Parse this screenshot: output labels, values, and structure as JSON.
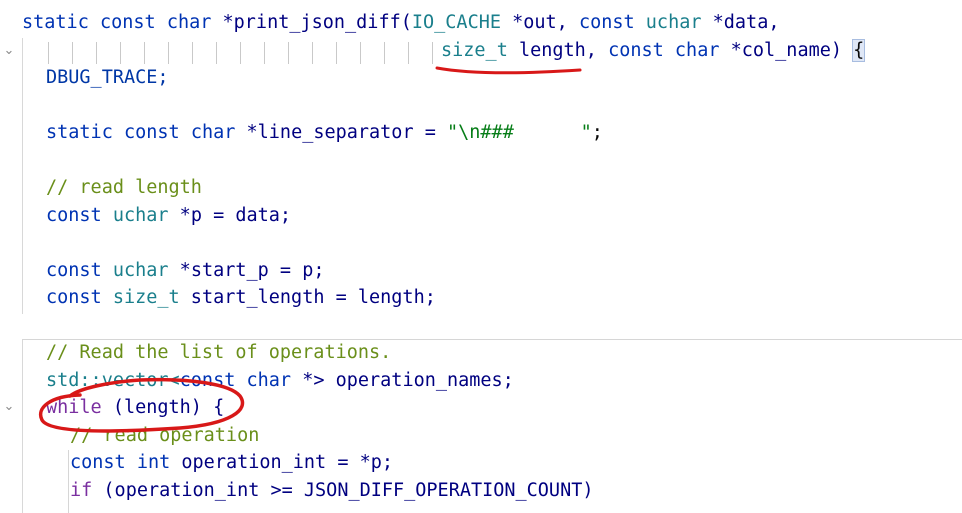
{
  "code": {
    "l1": {
      "static": "static",
      "const": "const",
      "char": "char",
      "func": "*print_json_diff(",
      "iocache": "IO_CACHE",
      "out": " *out, ",
      "const2": "const",
      "uchar": "uchar",
      "data": " *data,"
    },
    "l2": {
      "size_t": "size_t",
      "length": " length, ",
      "const": "const",
      "char": "char",
      "colname": " *col_name) ",
      "brace": "{"
    },
    "l3": {
      "text": "DBUG_TRACE;"
    },
    "l4": {
      "static": "static",
      "const": "const",
      "char": "char",
      "name": " *line_separator = ",
      "str": "\"\\n###      \"",
      "semi": ";"
    },
    "l5": {
      "comment": "// read length"
    },
    "l6": {
      "const": "const",
      "uchar": "uchar",
      "rest": " *p = data;"
    },
    "l7": {
      "const": "const",
      "uchar": "uchar",
      "rest": " *start_p = p;"
    },
    "l8": {
      "const": "const",
      "size_t": "size_t",
      "rest": " start_length = length;"
    },
    "l9": {
      "comment": "// Read the list of operations."
    },
    "l10": {
      "std": "std::vector<",
      "const": "const",
      "char": " char",
      "rest": " *> operation_names;"
    },
    "l11": {
      "while": "while",
      "rest": " (length) {"
    },
    "l12": {
      "comment": "// read operation"
    },
    "l13": {
      "const": "const",
      "int": "int",
      "rest": " operation_int = *p;"
    },
    "l14": {
      "if": "if",
      "rest": " (operation_int >= JSON_DIFF_OPERATION_COUNT)"
    }
  },
  "colors": {
    "keyword": "#0033b3",
    "annotation": "#d81818"
  }
}
